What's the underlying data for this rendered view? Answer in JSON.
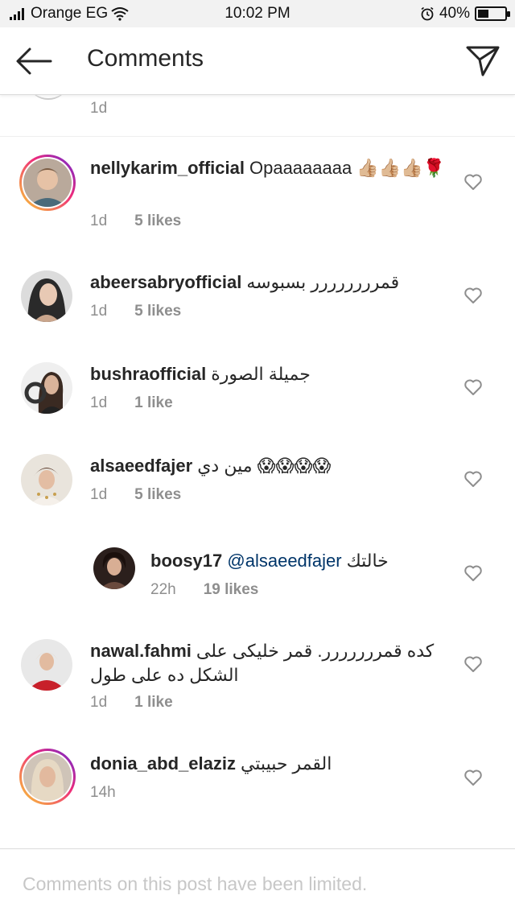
{
  "status": {
    "carrier": "Orange EG",
    "time": "10:02 PM",
    "battery": "40%",
    "battery_level": 0.4
  },
  "header": {
    "title": "Comments"
  },
  "top_comment": {
    "time": "1d"
  },
  "comments": [
    {
      "username": "nellykarim_official",
      "text": "Opaaaaaaaa 👍🏼👍🏼👍🏼🌹",
      "time": "1d",
      "likes": "5 likes",
      "story_ring": true
    },
    {
      "username": "abeersabryofficial",
      "text": "قمرررررررر بسبوسه",
      "time": "1d",
      "likes": "5 likes",
      "story_ring": false
    },
    {
      "username": "bushraofficial",
      "text": "جميلة الصورة",
      "time": "1d",
      "likes": "1 like",
      "story_ring": false
    },
    {
      "username": "alsaeedfajer",
      "text": "مين دي 😱😱😱😱",
      "time": "1d",
      "likes": "5 likes",
      "story_ring": false
    },
    {
      "username": "boosy17",
      "mention": "@alsaeedfajer",
      "text": "خالتك",
      "time": "22h",
      "likes": "19 likes",
      "reply": true
    },
    {
      "username": "nawal.fahmi",
      "text": "كده قمررررررر. قمر خليكى على الشكل ده على طول",
      "time": "1d",
      "likes": "1 like",
      "story_ring": false
    },
    {
      "username": "donia_abd_elaziz",
      "text": "القمر حبيبتي",
      "time": "14h",
      "likes": "",
      "story_ring": true
    }
  ],
  "footer": {
    "limited_text": "Comments on this post have been limited."
  },
  "icons": {
    "back": "arrow-left-icon",
    "send": "paper-plane-icon",
    "like": "heart-outline-icon"
  }
}
